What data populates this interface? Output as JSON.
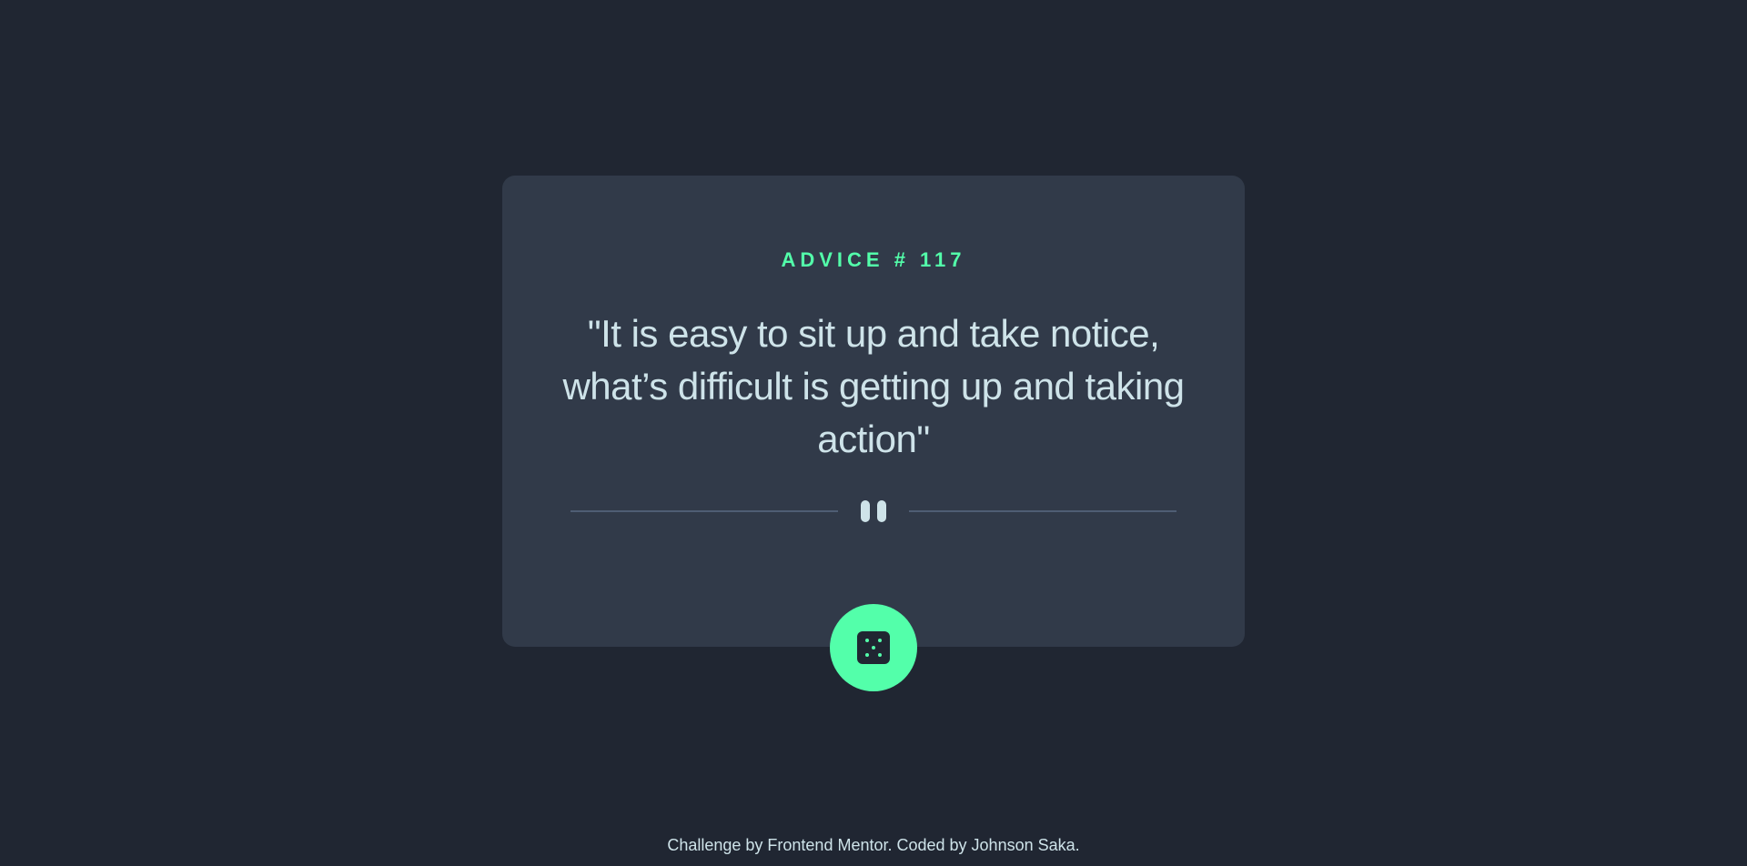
{
  "card": {
    "advice_label": "ADVICE # 117",
    "advice_text": "\"It is easy to sit up and take notice, what’s difficult is getting up and taking action\""
  },
  "icons": {
    "divider": "pause-quote-icon",
    "button": "dice-icon"
  },
  "footer": {
    "prefix": "Challenge by ",
    "mentor_link": "Frontend Mentor",
    "middle": ". Coded by ",
    "author_link": "Johnson Saka",
    "suffix": "."
  },
  "colors": {
    "background": "#202632",
    "card": "#313a49",
    "accent": "#53ffaa",
    "text": "#cee3e9",
    "divider": "#4f5d74"
  }
}
